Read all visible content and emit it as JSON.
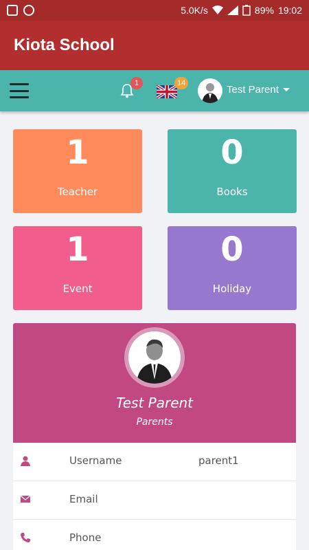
{
  "status_bar": {
    "net_speed": "5.0K/s",
    "battery": "89%",
    "time": "19:02"
  },
  "app": {
    "title": "Kiota School"
  },
  "nav": {
    "notifications_count": "1",
    "messages_count": "14",
    "user_name": "Test Parent",
    "icons": [
      "menu-icon",
      "bell-icon",
      "uk-flag-icon",
      "avatar",
      "caret-down-icon"
    ]
  },
  "stats": [
    {
      "value": "1",
      "label": "Teacher",
      "color": "#ff8a5c"
    },
    {
      "value": "0",
      "label": "Books",
      "color": "#4cb5ab"
    },
    {
      "value": "1",
      "label": "Event",
      "color": "#f15e8b"
    },
    {
      "value": "0",
      "label": "Holiday",
      "color": "#9678cf"
    }
  ],
  "profile": {
    "name": "Test Parent",
    "role": "Parents",
    "color": "#c14881"
  },
  "details": [
    {
      "key": "Username",
      "value": "parent1",
      "icon": "user-icon"
    },
    {
      "key": "Email",
      "value": "",
      "icon": "envelope-icon"
    },
    {
      "key": "Phone",
      "value": "",
      "icon": "phone-icon"
    }
  ],
  "colors": {
    "status_bar": "#a52a2a",
    "app_bar": "#b32e2e",
    "nav_bar": "#4cb5ab",
    "accent": "#c14881"
  }
}
